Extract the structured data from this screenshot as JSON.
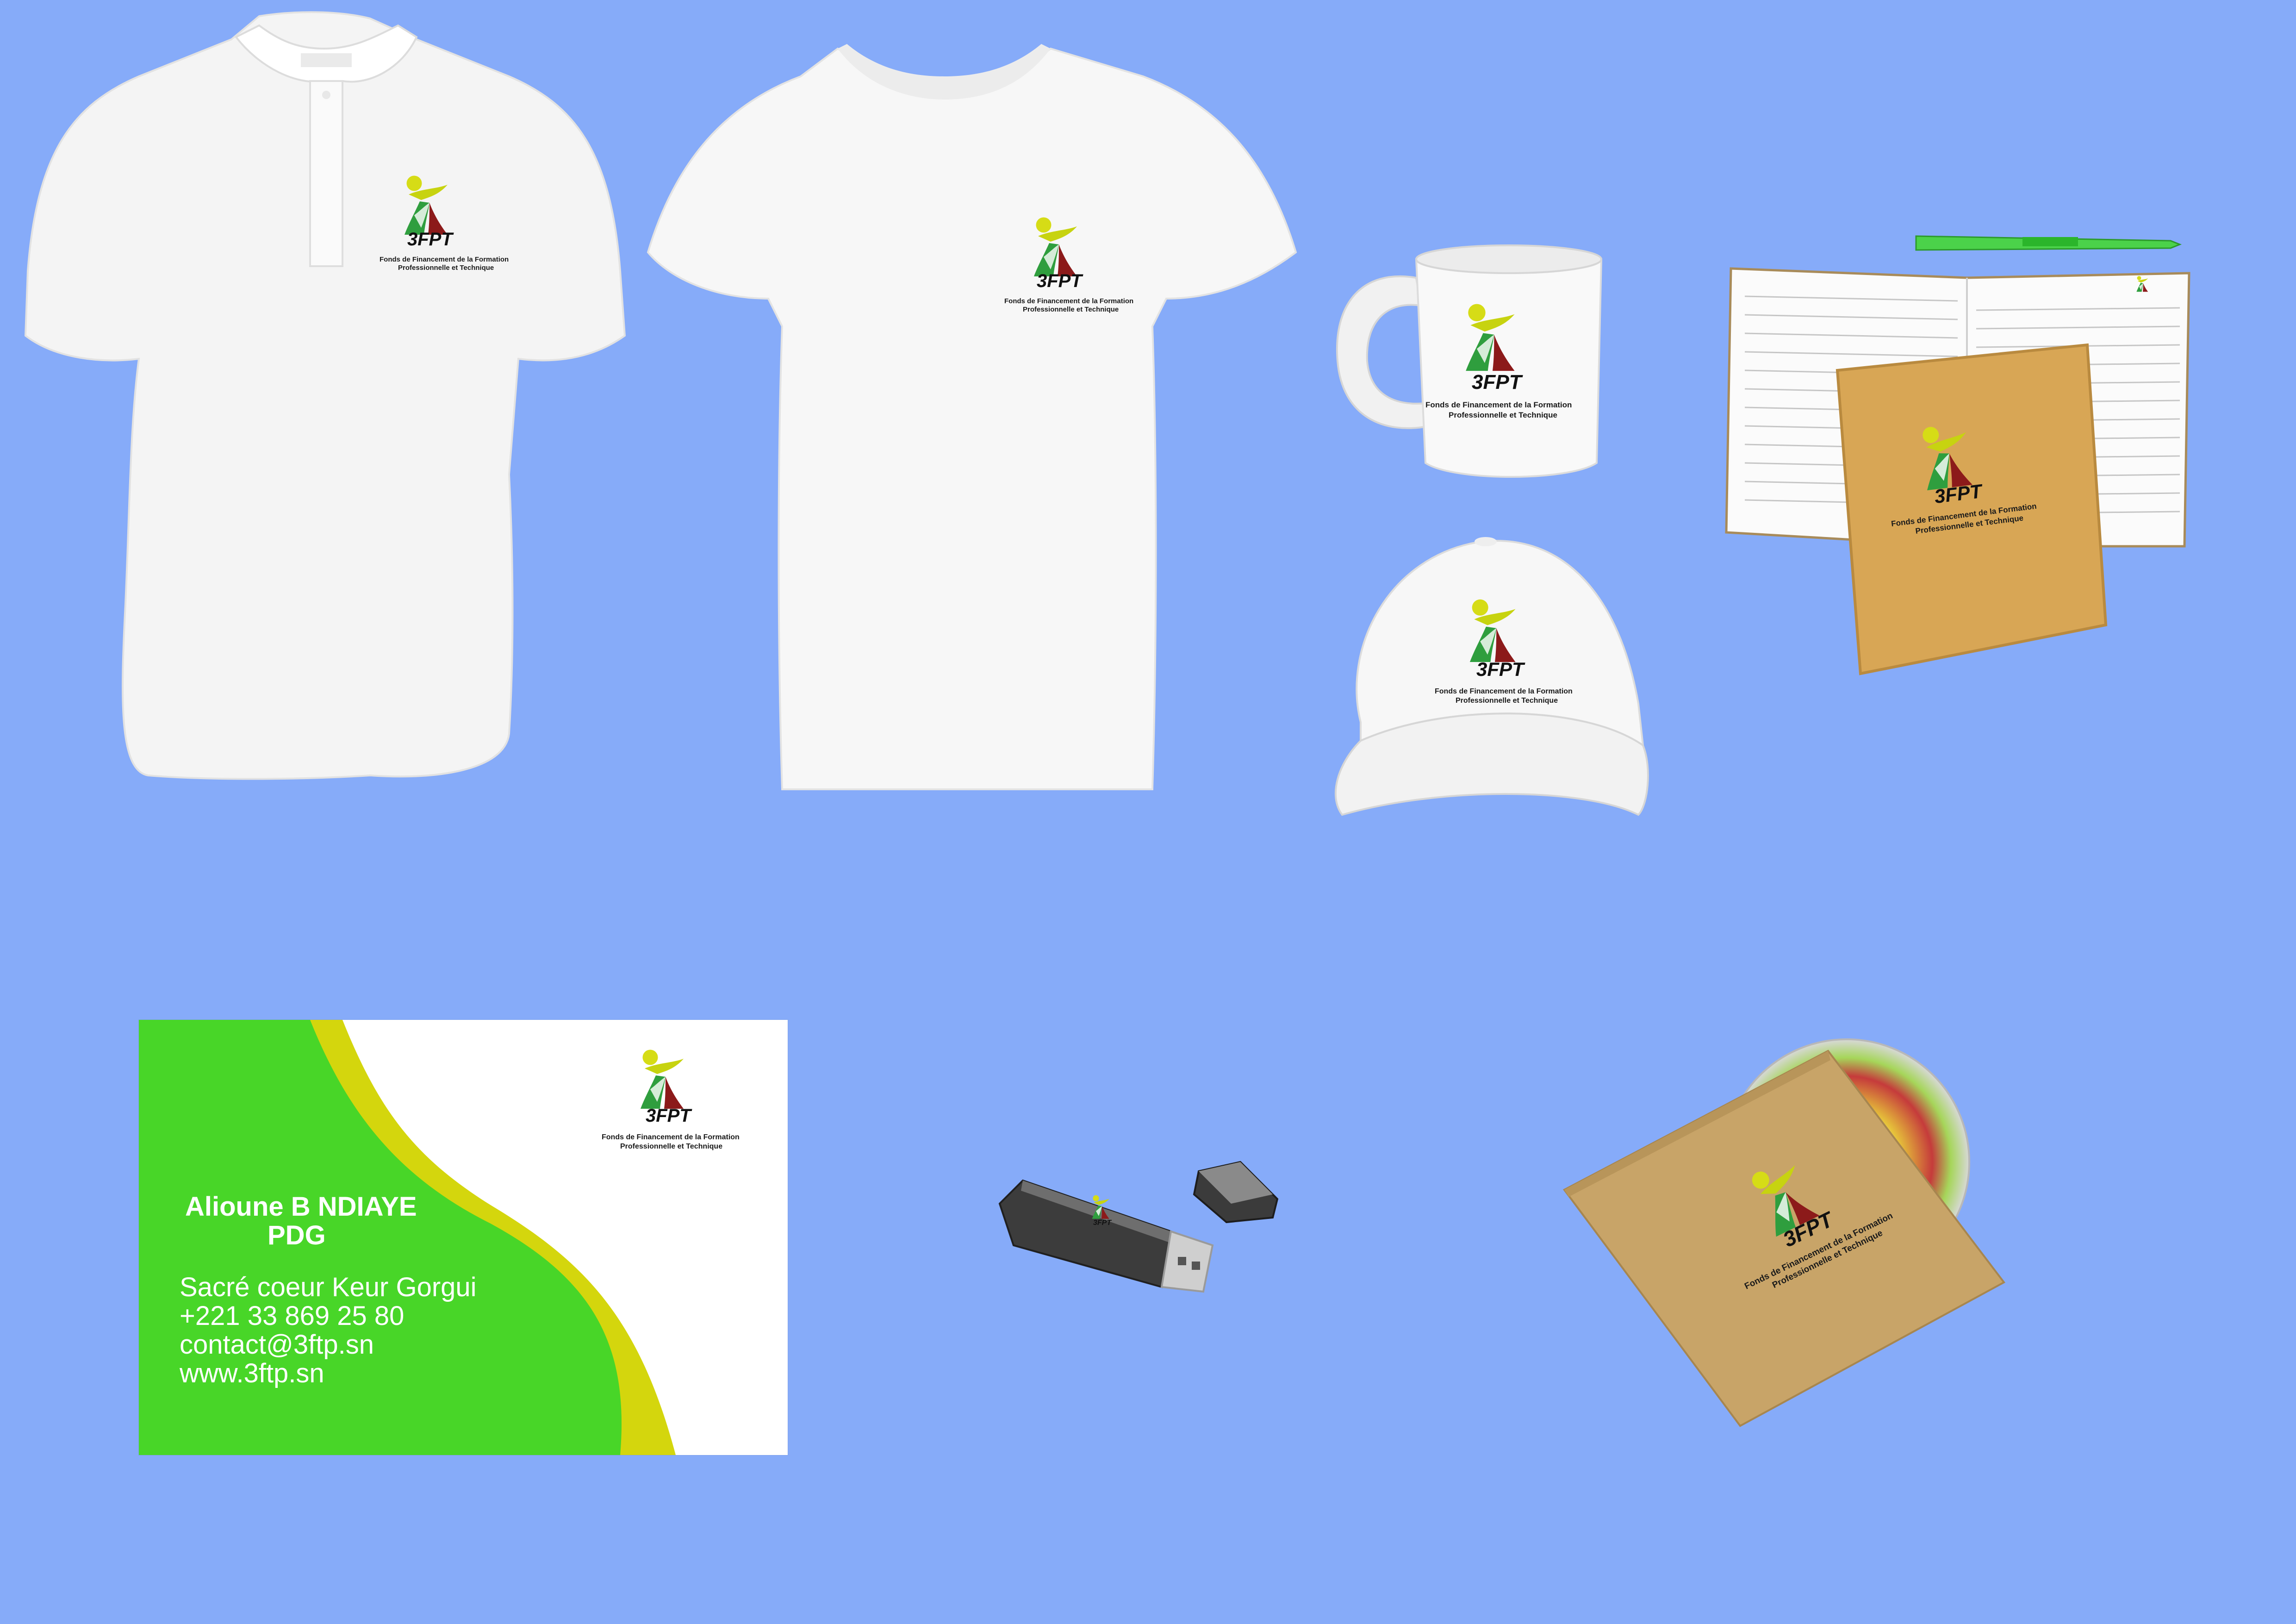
{
  "brand": {
    "name": "3FPT",
    "tagline_1": "Fonds de Financement de la Formation",
    "tagline_2": "Professionnelle et Technique",
    "colors": {
      "background": "#86abf9",
      "logo_yellow": "#d6dc16",
      "logo_green": "#2f9e3e",
      "logo_red": "#8c1a1a",
      "card_green": "#3fd11f",
      "card_yellow": "#d4d60d"
    }
  },
  "items": [
    {
      "id": "polo-shirt",
      "icon": "polo-shirt-icon"
    },
    {
      "id": "t-shirt",
      "icon": "t-shirt-icon"
    },
    {
      "id": "mug",
      "icon": "mug-icon"
    },
    {
      "id": "cap",
      "icon": "cap-icon"
    },
    {
      "id": "notebook-pen",
      "icon": "notebook-icon"
    },
    {
      "id": "usb-drive",
      "icon": "usb-drive-icon"
    },
    {
      "id": "cd-sleeve",
      "icon": "cd-icon"
    }
  ],
  "business_card": {
    "name": "Alioune B NDIAYE",
    "title": "PDG",
    "address": "Sacré coeur Keur Gorgui",
    "phone": "+221 33 869 25 80",
    "email": "contact@3ftp.sn",
    "website": "www.3ftp.sn"
  }
}
